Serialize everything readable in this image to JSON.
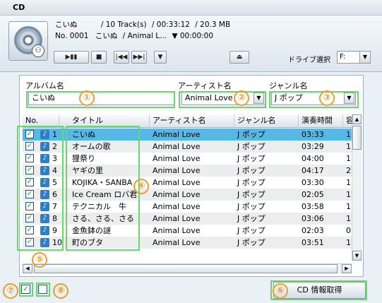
{
  "window": {
    "title": "CD"
  },
  "player": {
    "line1_title": "こいぬ",
    "line1_tracks": "/ 10 Track(s)",
    "line1_duration": "/ 00:33:12",
    "line1_size": "/ 20.3 MB",
    "line2_no": "No. 0001",
    "line2_title": "こいぬ",
    "line2_artist": "/ Animal L...",
    "line2_time": "▼ 00:00:00",
    "drive_label": "ドライブ選択",
    "drive_value": "F:"
  },
  "fields": {
    "album_label": "アルバム名",
    "album_value": "こいぬ",
    "artist_label": "アーティスト名",
    "artist_value": "Animal Love",
    "genre_label": "ジャンル名",
    "genre_value": "J ポップ"
  },
  "table": {
    "headers": [
      "No.",
      "タイトル",
      "アーティスト名",
      "ジャンル名",
      "演奏時間",
      "容"
    ],
    "rows": [
      {
        "no": "1",
        "title": "こいぬ",
        "artist": "Animal Love",
        "genre": "J ポップ",
        "time": "03:33",
        "size": "1"
      },
      {
        "no": "2",
        "title": "オームの歌",
        "artist": "Animal Love",
        "genre": "J ポップ",
        "time": "03:29",
        "size": "1"
      },
      {
        "no": "3",
        "title": "狸祭り",
        "artist": "Animal Love",
        "genre": "J ポップ",
        "time": "04:00",
        "size": "1"
      },
      {
        "no": "4",
        "title": "ヤギの里",
        "artist": "Animal Love",
        "genre": "J ポップ",
        "time": "04:17",
        "size": "2"
      },
      {
        "no": "5",
        "title": "KOJIKA・SANBA",
        "artist": "Animal Love",
        "genre": "J ポップ",
        "time": "03:30",
        "size": "1"
      },
      {
        "no": "6",
        "title": "Ice Cream ロバ君",
        "artist": "Animal Love",
        "genre": "J ポップ",
        "time": "02:05",
        "size": "1"
      },
      {
        "no": "7",
        "title": "テクニカル　牛",
        "artist": "Animal Love",
        "genre": "J ポップ",
        "time": "03:58",
        "size": "1"
      },
      {
        "no": "8",
        "title": "さる、さる、さる",
        "artist": "Animal Love",
        "genre": "J ポップ",
        "time": "03:06",
        "size": "1"
      },
      {
        "no": "9",
        "title": "金魚鉢の謎",
        "artist": "Animal Love",
        "genre": "J ポップ",
        "time": "02:03",
        "size": "0"
      },
      {
        "no": "10",
        "title": "町のブタ",
        "artist": "Animal Love",
        "genre": "J ポップ",
        "time": "03:51",
        "size": "1"
      }
    ]
  },
  "buttons": {
    "cd_info": "CD 情報取得"
  },
  "callouts": [
    "①",
    "②",
    "③",
    "④",
    "⑤",
    "⑥",
    "⑦",
    "⑧"
  ],
  "colors": {
    "selection": "#56b8e6",
    "highlight": "#6bd66b",
    "callout": "#f29a2c"
  }
}
